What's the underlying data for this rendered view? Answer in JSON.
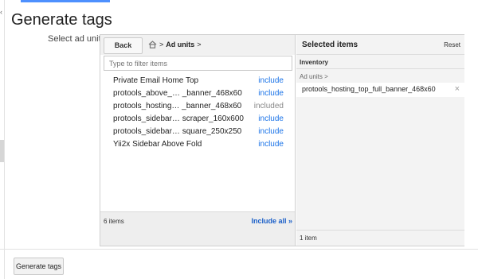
{
  "page": {
    "title": "Generate tags"
  },
  "field": {
    "label": "Select ad units"
  },
  "browser": {
    "back_label": "Back",
    "breadcrumb": {
      "separator": ">",
      "current": "Ad units",
      "trailing": ">"
    },
    "filter": {
      "placeholder": "Type to filter items",
      "value": ""
    },
    "items": [
      {
        "name": "Private Email Home Top",
        "action": "include"
      },
      {
        "name": "protools_above_… _banner_468x60",
        "action": "include"
      },
      {
        "name": "protools_hosting… _banner_468x60",
        "action": "included"
      },
      {
        "name": "protools_sidebar… scraper_160x600",
        "action": "include"
      },
      {
        "name": "protools_sidebar… square_250x250",
        "action": "include"
      },
      {
        "name": "Yii2x Sidebar Above Fold",
        "action": "include"
      }
    ],
    "footer": {
      "count": "6 items",
      "include_all": "Include all »"
    }
  },
  "selected": {
    "title": "Selected items",
    "reset_label": "Reset",
    "section": "Inventory",
    "sub_crumb": "Ad units >",
    "items": [
      {
        "name": "protools_hosting_top_full_banner_468x60",
        "remove": "×"
      }
    ],
    "footer": {
      "count": "1 item"
    }
  },
  "actions": {
    "generate_label": "Generate tags"
  },
  "icons": {
    "home": "home-icon",
    "remove": "close-icon"
  },
  "colors": {
    "link": "#1a73e8",
    "accent": "#4d90fe",
    "muted": "#888888"
  }
}
